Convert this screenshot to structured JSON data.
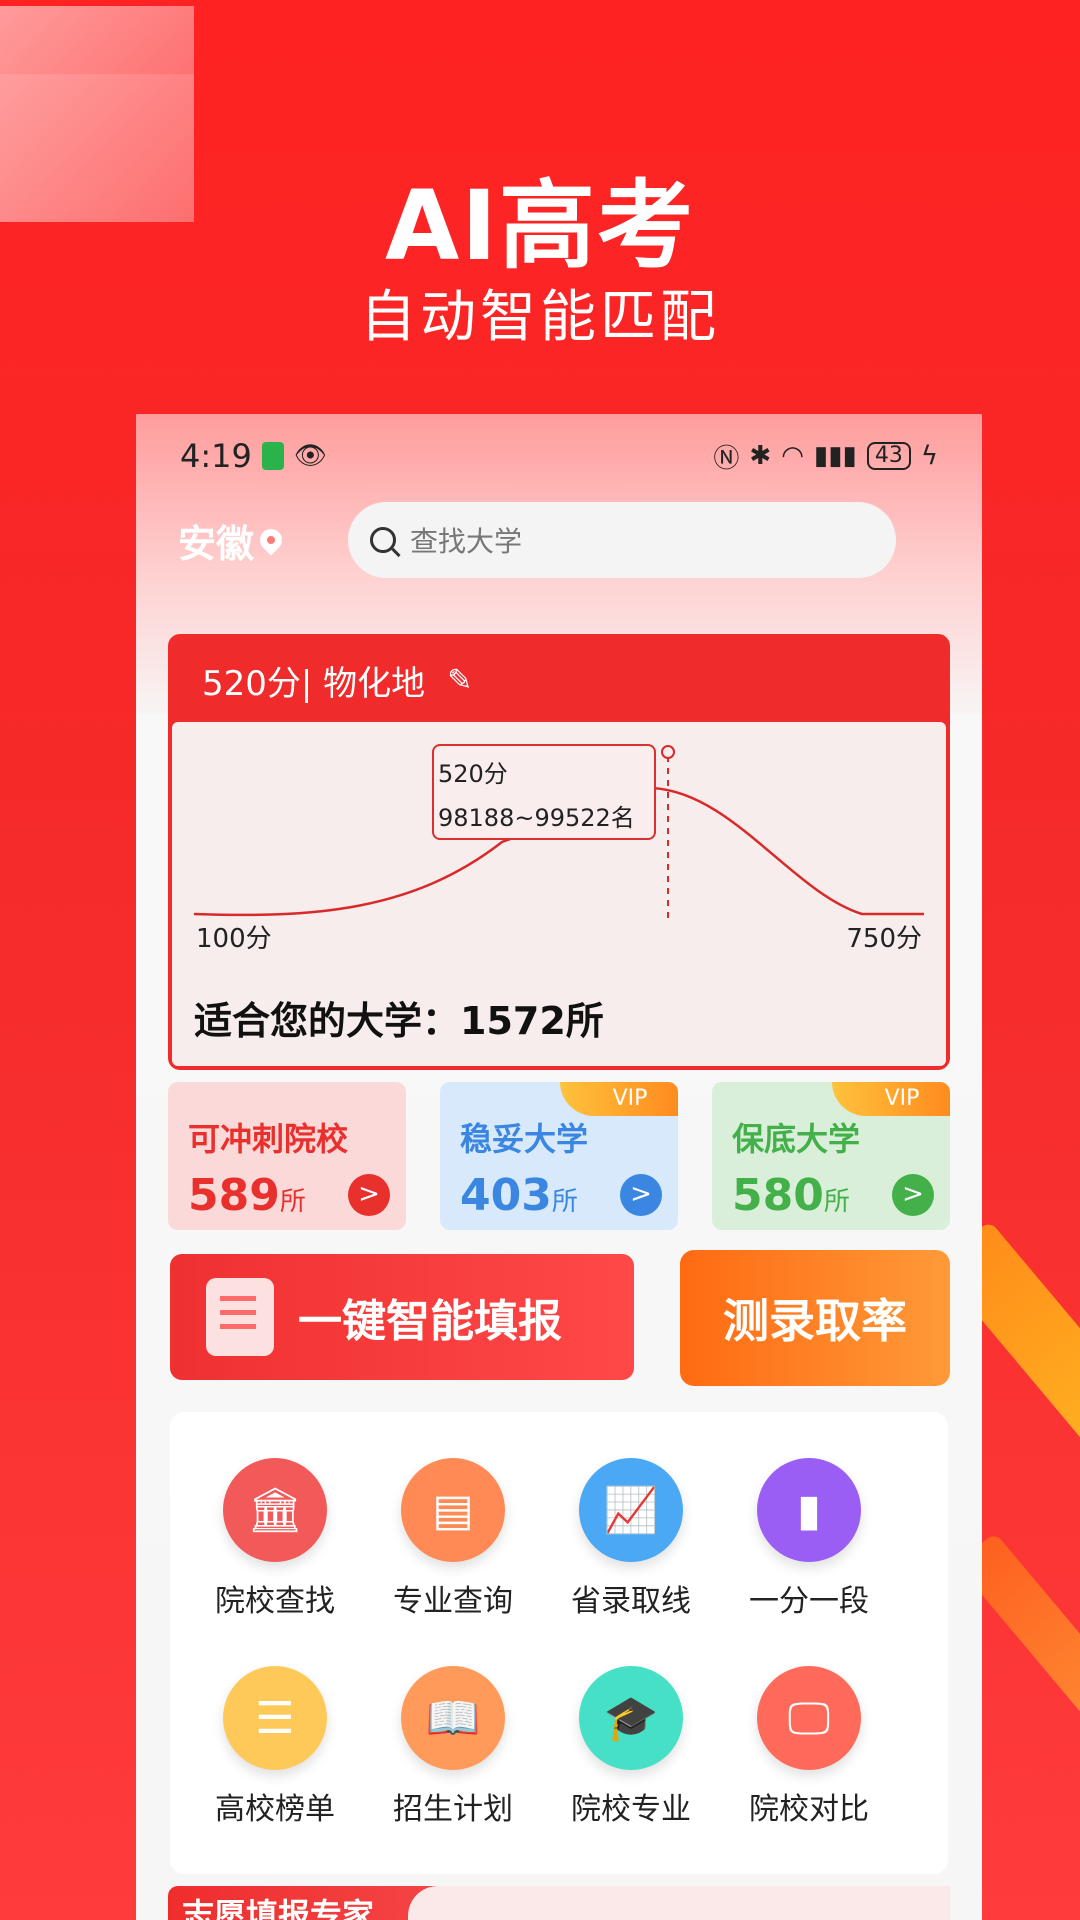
{
  "hero": {
    "title": "AI高考",
    "subtitle": "自动智能匹配"
  },
  "status_bar": {
    "time": "4:19",
    "battery": "43"
  },
  "header": {
    "location": "安徽",
    "search_placeholder": "查找大学"
  },
  "score_card": {
    "summary": "520分| 物化地",
    "tooltip_score": "520分",
    "tooltip_rank": "98188~99522名",
    "axis_min": "100分",
    "axis_max": "750分",
    "fit_label": "适合您的大学：1572所",
    "score_value": 520,
    "score_range": [
      100,
      750
    ]
  },
  "tiers": [
    {
      "title": "可冲刺院校",
      "count": "589",
      "unit": "所",
      "vip": "",
      "color": "#e8302d",
      "arrow_color": "#e8302d"
    },
    {
      "title": "稳妥大学",
      "count": "403",
      "unit": "所",
      "vip": "VIP",
      "color": "#3a86e0",
      "arrow_color": "#3a86e0"
    },
    {
      "title": "保底大学",
      "count": "580",
      "unit": "所",
      "vip": "VIP",
      "color": "#43b04a",
      "arrow_color": "#43b04a"
    }
  ],
  "actions": {
    "fill_label": "一键智能填报",
    "rate_label": "测录取率"
  },
  "grid": [
    {
      "label": "院校查找",
      "icon": "building-icon",
      "color": "#f25a5a"
    },
    {
      "label": "专业查询",
      "icon": "book-icon",
      "color": "#ff8a55"
    },
    {
      "label": "省录取线",
      "icon": "chart-up-icon",
      "color": "#4aa8f5"
    },
    {
      "label": "一分一段",
      "icon": "bar-chart-icon",
      "color": "#9b5ef5"
    },
    {
      "label": "高校榜单",
      "icon": "list-icon",
      "color": "#ffc95a"
    },
    {
      "label": "招生计划",
      "icon": "plan-book-icon",
      "color": "#ff9a5a"
    },
    {
      "label": "院校专业",
      "icon": "graduation-cap-icon",
      "color": "#45e0c5"
    },
    {
      "label": "院校对比",
      "icon": "compare-chart-icon",
      "color": "#ff6a5a"
    }
  ],
  "banner": {
    "title": "志愿填报专家"
  }
}
